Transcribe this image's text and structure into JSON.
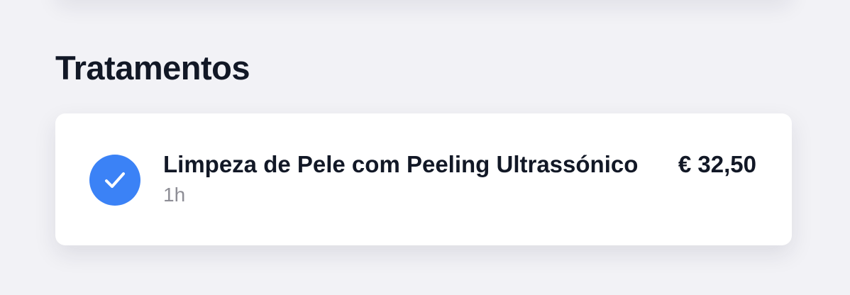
{
  "section": {
    "title": "Tratamentos"
  },
  "treatment": {
    "name": "Limpeza de Pele com Peeling Ultrassónico",
    "duration": "1h",
    "price": "€ 32,50",
    "selected": true,
    "check_icon": "checkmark-icon",
    "accent_color": "#3b82f6"
  }
}
